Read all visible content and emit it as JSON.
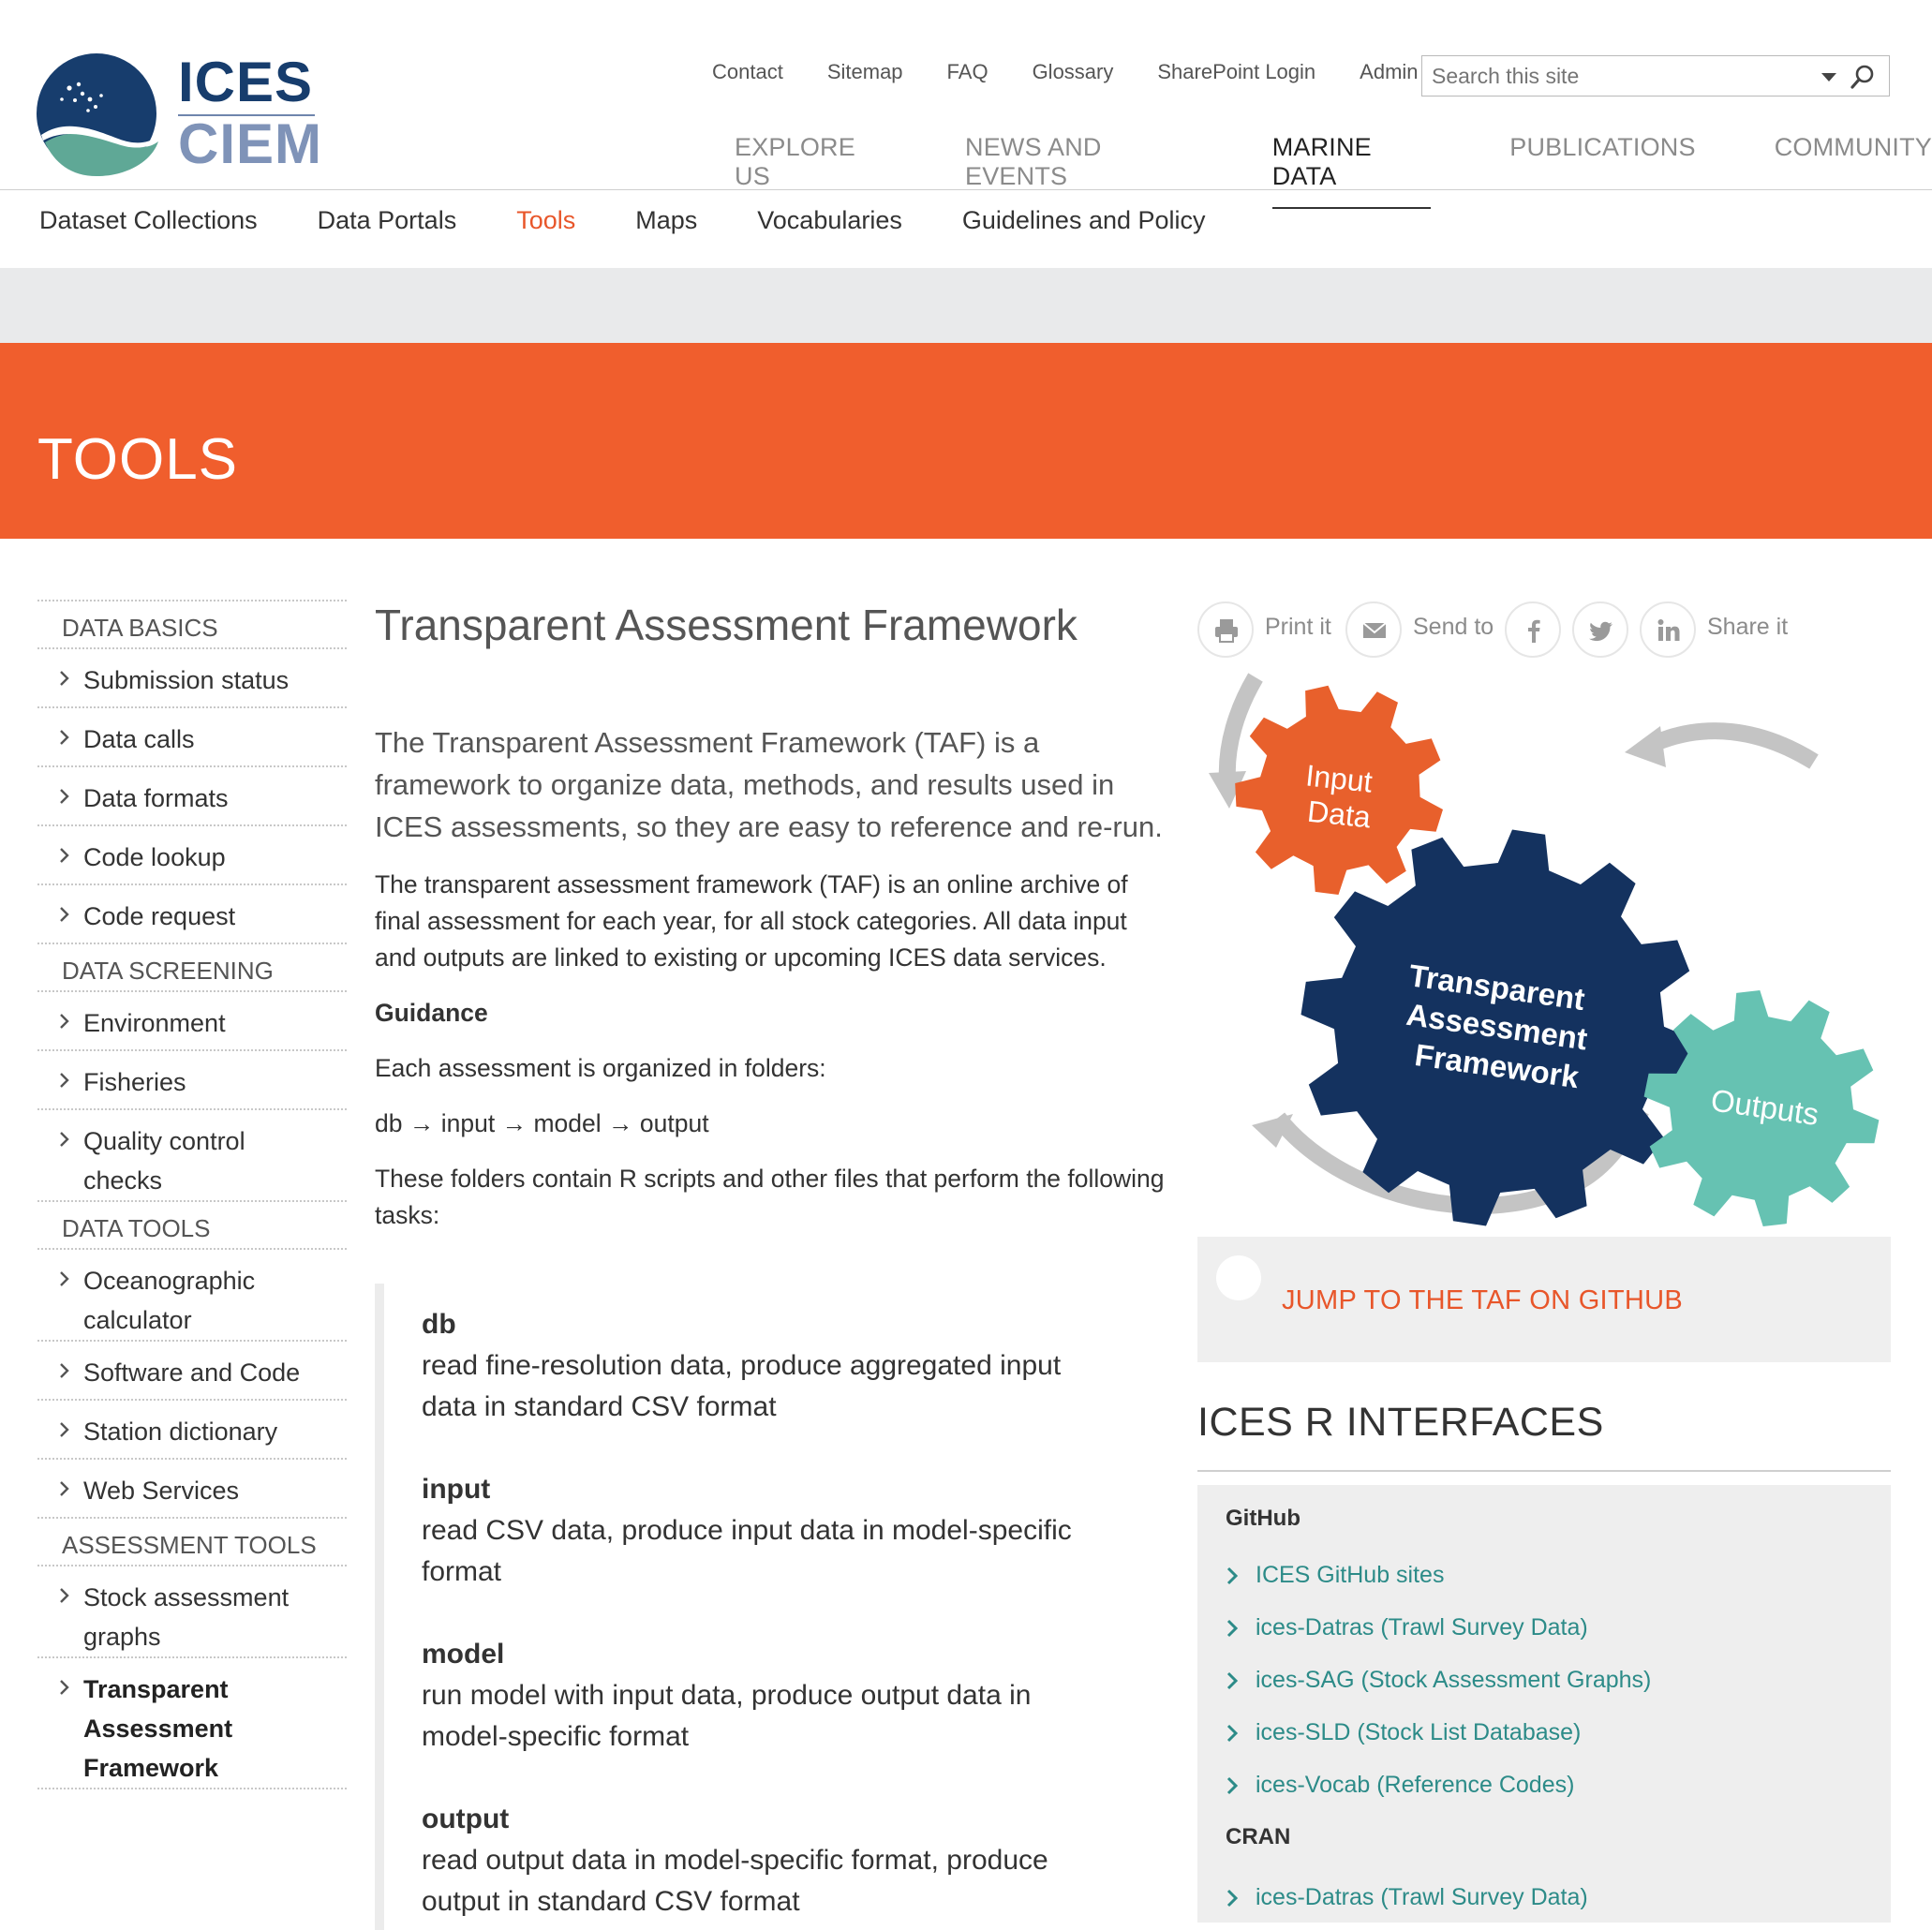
{
  "logo": {
    "line1": "ICES",
    "line2": "CIEM",
    "colors": {
      "navy": "#173d6d",
      "light": "#7f93b8",
      "teal": "#5fa896"
    }
  },
  "utility_nav": [
    "Contact",
    "Sitemap",
    "FAQ",
    "Glossary",
    "SharePoint Login",
    "Admin"
  ],
  "search": {
    "placeholder": "Search this site",
    "icon": "search-icon"
  },
  "main_nav": [
    {
      "label": "EXPLORE US",
      "active": false
    },
    {
      "label": "NEWS AND EVENTS",
      "active": false
    },
    {
      "label": "MARINE DATA",
      "active": true
    },
    {
      "label": "PUBLICATIONS",
      "active": false
    },
    {
      "label": "COMMUNITY",
      "active": false
    }
  ],
  "sub_nav": [
    {
      "label": "Dataset Collections",
      "active": false
    },
    {
      "label": "Data Portals",
      "active": false
    },
    {
      "label": "Tools",
      "active": true
    },
    {
      "label": "Maps",
      "active": false
    },
    {
      "label": "Vocabularies",
      "active": false
    },
    {
      "label": "Guidelines and Policy",
      "active": false
    }
  ],
  "hero": {
    "title": "TOOLS",
    "color": "#f05e2d"
  },
  "sidebar": {
    "sections": [
      {
        "heading": "DATA BASICS",
        "items": [
          {
            "lines": [
              "Submission status"
            ]
          },
          {
            "lines": [
              "Data calls"
            ]
          },
          {
            "lines": [
              "Data formats"
            ]
          },
          {
            "lines": [
              "Code lookup"
            ]
          },
          {
            "lines": [
              "Code request"
            ]
          }
        ]
      },
      {
        "heading": "DATA SCREENING",
        "items": [
          {
            "lines": [
              "Environment"
            ]
          },
          {
            "lines": [
              "Fisheries"
            ]
          },
          {
            "lines": [
              "Quality control",
              "checks"
            ]
          }
        ]
      },
      {
        "heading": "DATA TOOLS",
        "items": [
          {
            "lines": [
              "Oceanographic",
              "calculator"
            ]
          },
          {
            "lines": [
              "Software and Code"
            ]
          },
          {
            "lines": [
              "Station dictionary"
            ]
          },
          {
            "lines": [
              "Web Services"
            ]
          }
        ]
      },
      {
        "heading": "ASSESSMENT TOOLS",
        "items": [
          {
            "lines": [
              "Stock assessment",
              "graphs"
            ]
          },
          {
            "lines": [
              "Transparent",
              "Assessment",
              "Framework"
            ],
            "current": true
          }
        ]
      }
    ]
  },
  "content": {
    "title": "Transparent Assessment Framework",
    "lead": "The Transparent Assessment Framework (TAF) is a framework to organize data, methods, and results used in ICES assessments, so they are easy to reference and re-run.",
    "intro": "The transparent assessment framework (TAF) is an online archive of final assessment for each year, for all stock categories. All data input and outputs are linked to existing or upcoming ICES data services.",
    "guidance_heading": "Guidance",
    "folders_text": "Each assessment is organized in folders:",
    "flow": [
      "db",
      "input",
      "model",
      "output"
    ],
    "tasks_text": "These folders contain R scripts and other files that perform the following tasks:",
    "tasks": [
      {
        "name": "db",
        "lines": [
          "read fine-resolution data, produce aggregated input",
          "data in standard CSV format"
        ]
      },
      {
        "name": "input",
        "lines": [
          "read CSV data, produce input data in model-specific",
          "format"
        ]
      },
      {
        "name": "model",
        "lines": [
          "run model with input data, produce output data in",
          "model-specific format"
        ]
      },
      {
        "name": "output",
        "lines": [
          "read output data in model-specific format, produce",
          "output in standard CSV format"
        ]
      }
    ]
  },
  "share": {
    "print_label": "Print it",
    "send_label": "Send to",
    "share_label": "Share it",
    "icons": [
      "print-icon",
      "mail-icon",
      "facebook-icon",
      "twitter-icon",
      "linkedin-icon"
    ]
  },
  "taf_diagram": {
    "gear_input": [
      "Input",
      "Data"
    ],
    "gear_taf": [
      "Transparent",
      "Assessment",
      "Framework"
    ],
    "gear_outputs": [
      "Outputs"
    ],
    "colors": {
      "input": "#e8602c",
      "taf": "#14325f",
      "outputs": "#66c2b2",
      "arrows": "#c4c4c4"
    }
  },
  "github_box": {
    "link": "JUMP TO THE TAF ON GITHUB"
  },
  "r_interfaces": {
    "title": "ICES R INTERFACES",
    "groups": [
      {
        "name": "GitHub",
        "links": [
          "ICES GitHub sites",
          "ices-Datras (Trawl Survey Data)",
          "ices-SAG (Stock Assessment Graphs)",
          "ices-SLD (Stock List Database)",
          "ices-Vocab (Reference Codes)"
        ]
      },
      {
        "name": "CRAN",
        "links": [
          "ices-Datras (Trawl Survey Data)"
        ]
      }
    ]
  }
}
